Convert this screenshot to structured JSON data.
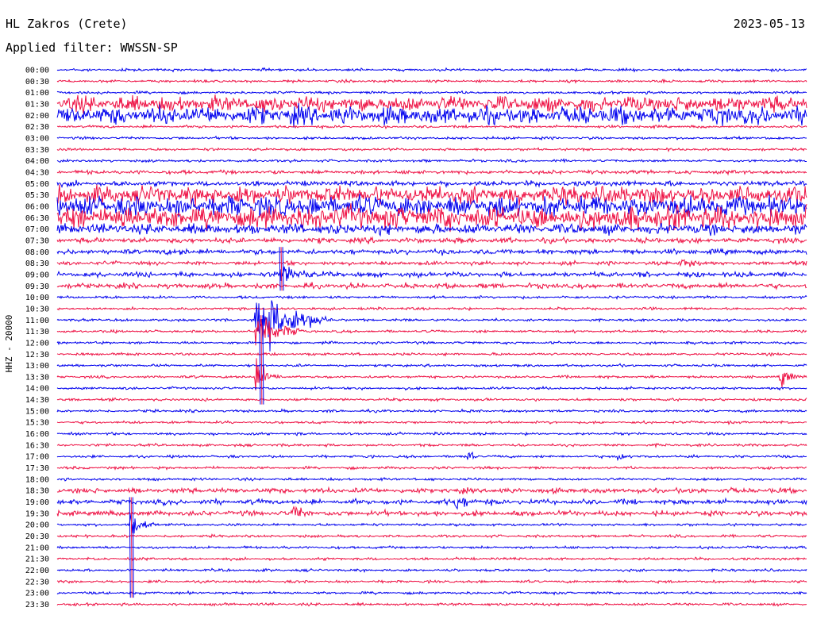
{
  "header": {
    "station": "HL Zakros (Crete)",
    "date": "2023-05-13",
    "filter": "Applied filter: WWSSN-SP"
  },
  "chart_data": {
    "type": "line",
    "ylabel": "HHZ - 20000",
    "row_labels": [
      "00:00",
      "00:30",
      "01:00",
      "01:30",
      "02:00",
      "02:30",
      "03:00",
      "03:30",
      "04:00",
      "04:30",
      "05:00",
      "05:30",
      "06:00",
      "06:30",
      "07:00",
      "07:30",
      "08:00",
      "08:30",
      "09:00",
      "09:30",
      "10:00",
      "10:30",
      "11:00",
      "11:30",
      "12:00",
      "12:30",
      "13:00",
      "13:30",
      "14:00",
      "14:30",
      "15:00",
      "15:30",
      "16:00",
      "16:30",
      "17:00",
      "17:30",
      "18:00",
      "18:30",
      "19:00",
      "19:30",
      "20:00",
      "20:30",
      "21:00",
      "21:30",
      "22:00",
      "22:30",
      "23:00",
      "23:30"
    ],
    "colors": [
      "#0000ee",
      "#ee1144"
    ],
    "noise_level": [
      1,
      1,
      1,
      6,
      7,
      1,
      1,
      1,
      1,
      1.5,
      2,
      7,
      8,
      9,
      4,
      2,
      2,
      1.5,
      2,
      2,
      1,
      1,
      1,
      1,
      1,
      1,
      1,
      1,
      1,
      1,
      1,
      1,
      1,
      1,
      1,
      1,
      1,
      2,
      2,
      2,
      1,
      1,
      1,
      1,
      1,
      1,
      1,
      1
    ],
    "events": [
      {
        "row": 4,
        "minute": 2,
        "amp": 8,
        "duration_min": 2
      },
      {
        "row": 4,
        "minute": 9,
        "amp": 9,
        "duration_min": 2
      },
      {
        "row": 16,
        "minute": 5,
        "amp": 5,
        "duration_min": 1
      },
      {
        "row": 17,
        "minute": 25,
        "amp": 6,
        "duration_min": 2
      },
      {
        "row": 18,
        "minute": 9,
        "amp": 12,
        "duration_min": 2
      },
      {
        "row": 22,
        "minute": 8,
        "amp": 35,
        "duration_min": 3
      },
      {
        "row": 23,
        "minute": 8,
        "amp": 20,
        "duration_min": 2
      },
      {
        "row": 27,
        "minute": 8,
        "amp": 18,
        "duration_min": 1
      },
      {
        "row": 27,
        "minute": 29,
        "amp": 10,
        "duration_min": 1
      },
      {
        "row": 38,
        "minute": 16,
        "amp": 9,
        "duration_min": 1.5
      },
      {
        "row": 39,
        "minute": 9.5,
        "amp": 10,
        "duration_min": 1
      },
      {
        "row": 40,
        "minute": 3,
        "amp": 14,
        "duration_min": 1
      },
      {
        "row": 34,
        "minute": 16.5,
        "amp": 6,
        "duration_min": 0.5
      },
      {
        "row": 34,
        "minute": 22.5,
        "amp": 6,
        "duration_min": 0.5
      }
    ],
    "spikes": [
      {
        "row_start": 22,
        "row_end": 29,
        "minute": 8.1
      },
      {
        "row_start": 16,
        "row_end": 19,
        "minute": 8.9
      },
      {
        "row_start": 38,
        "row_end": 46,
        "minute": 2.9
      }
    ]
  }
}
